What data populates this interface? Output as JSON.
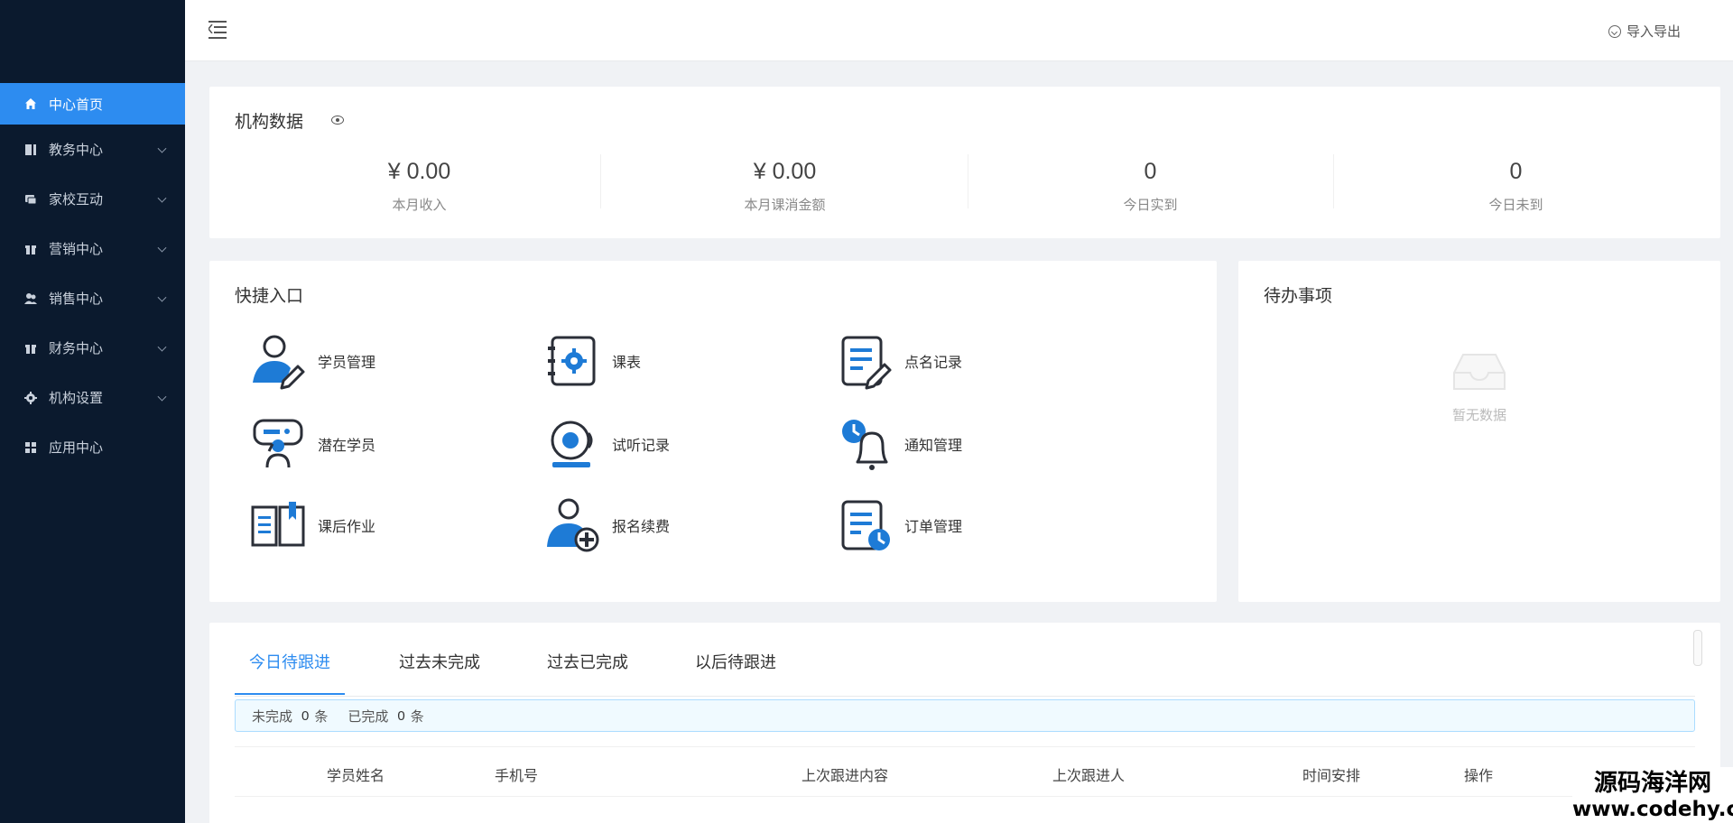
{
  "sidebar": {
    "items": [
      {
        "label": "中心首页",
        "icon": "home-icon",
        "active": true
      },
      {
        "label": "教务中心",
        "icon": "book-icon"
      },
      {
        "label": "家校互动",
        "icon": "chat-icon"
      },
      {
        "label": "营销中心",
        "icon": "gift-icon"
      },
      {
        "label": "销售中心",
        "icon": "users-icon"
      },
      {
        "label": "财务中心",
        "icon": "wallet-icon"
      },
      {
        "label": "机构设置",
        "icon": "gear-icon"
      },
      {
        "label": "应用中心",
        "icon": "grid-icon"
      }
    ]
  },
  "header": {
    "import_export": "导入导出"
  },
  "org_data": {
    "title": "机构数据",
    "stats": [
      {
        "value": "¥ 0.00",
        "label": "本月收入"
      },
      {
        "value": "¥ 0.00",
        "label": "本月课消金额"
      },
      {
        "value": "0",
        "label": "今日实到"
      },
      {
        "value": "0",
        "label": "今日未到"
      }
    ]
  },
  "quick": {
    "title": "快捷入口",
    "items": [
      {
        "label": "学员管理",
        "icon": "student-edit-icon"
      },
      {
        "label": "课表",
        "icon": "schedule-gear-icon"
      },
      {
        "label": "点名记录",
        "icon": "notepad-edit-icon"
      },
      {
        "label": "潜在学员",
        "icon": "prospect-chat-icon"
      },
      {
        "label": "试听记录",
        "icon": "bell-ring-icon"
      },
      {
        "label": "通知管理",
        "icon": "alarm-bell-icon"
      },
      {
        "label": "课后作业",
        "icon": "open-book-icon"
      },
      {
        "label": "报名续费",
        "icon": "user-add-icon"
      },
      {
        "label": "订单管理",
        "icon": "order-clock-icon"
      }
    ]
  },
  "todo": {
    "title": "待办事项",
    "empty_text": "暂无数据"
  },
  "followup": {
    "tabs": [
      "今日待跟进",
      "过去未完成",
      "过去已完成",
      "以后待跟进"
    ],
    "summary": {
      "incomplete_label": "未完成",
      "incomplete_count": "0",
      "unit": "条",
      "complete_label": "已完成",
      "complete_count": "0",
      "unit2": "条"
    },
    "columns": [
      "学员姓名",
      "手机号",
      "上次跟进内容",
      "上次跟进人",
      "时间安排",
      "操作"
    ]
  },
  "watermark": {
    "line1": "源码海洋网",
    "line2": "www.codehy.com"
  },
  "colors": {
    "sidebar": "#0b1a2e",
    "accent": "#2d8cf0",
    "icon_dark": "#2b2f38",
    "icon_blue": "#1e7bd6"
  }
}
